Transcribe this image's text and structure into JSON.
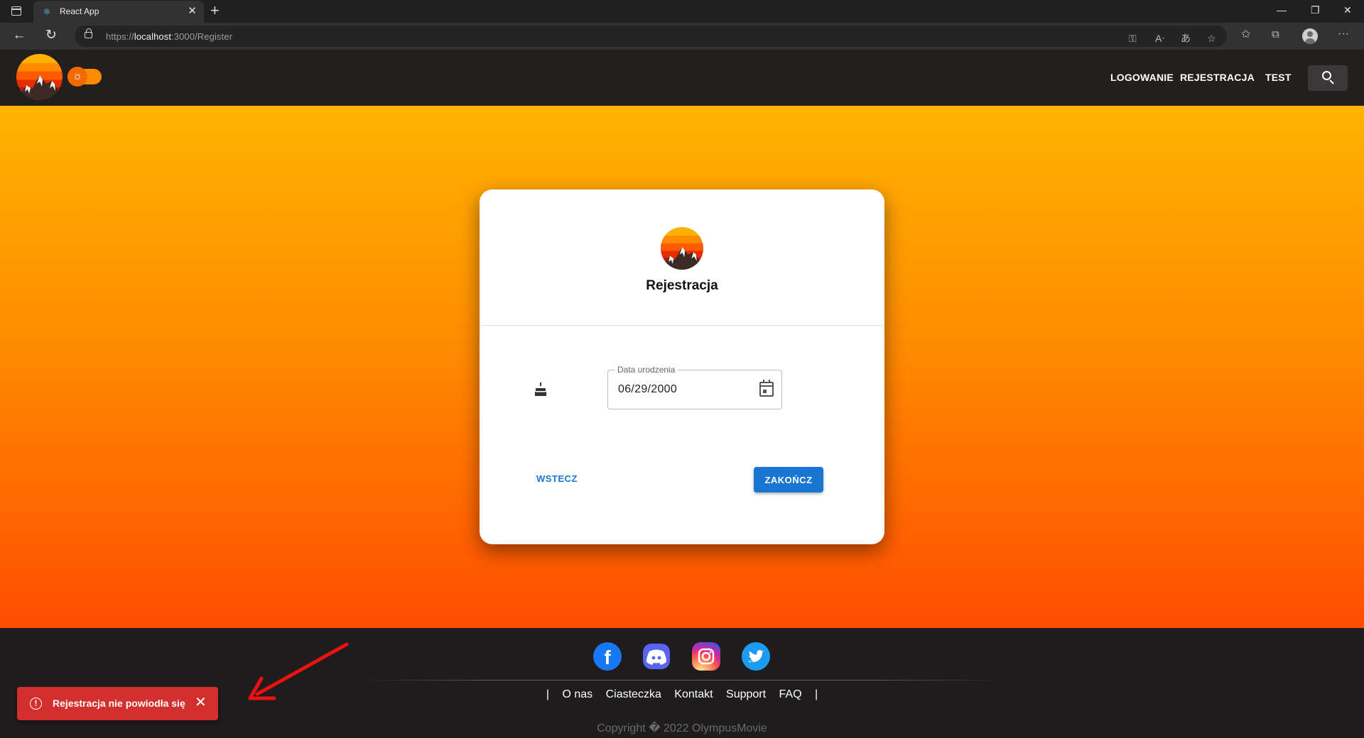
{
  "browser": {
    "tab_title": "React App",
    "url_prefix": "https://",
    "url_host": "localhost",
    "url_path": ":3000/Register"
  },
  "header": {
    "nav": [
      "LOGOWANIE",
      "REJESTRACJA",
      "TEST"
    ]
  },
  "card": {
    "title": "Rejestracja",
    "date_label": "Data urodzenia",
    "date_value": "06/29/2000",
    "back_label": "WSTECZ",
    "finish_label": "ZAKOŃCZ"
  },
  "footer": {
    "social": [
      "facebook-icon",
      "discord-icon",
      "instagram-icon",
      "twitter-icon"
    ],
    "links": [
      "O nas",
      "Ciasteczka",
      "Kontakt",
      "Support",
      "FAQ"
    ],
    "separator": "|",
    "copyright": "Copyright � 2022 OlympusMovie"
  },
  "toast": {
    "message": "Rejestracja nie powiodła się"
  },
  "colors": {
    "accent": "#1976d2",
    "error": "#d32f2f",
    "header_bg": "#221f1f",
    "gradient_top": "#ffb300",
    "gradient_bottom": "#ff4d00"
  }
}
